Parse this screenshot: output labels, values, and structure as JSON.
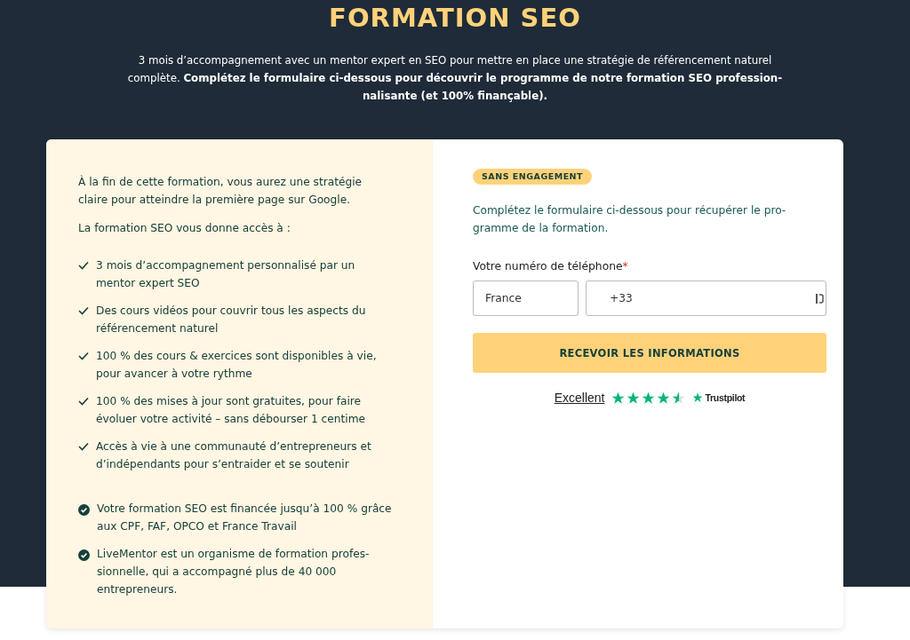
{
  "header": {
    "title": "FORMATION SEO",
    "intro": "3 mois d’accompagnement avec un mentor expert en SEO pour mettre en place une stratégie de référencement naturel complète. **Complétez le formulaire ci-dessous pour découvrir le programme de notre formation SEO profession-nalisante (et 100% finançable).**"
  },
  "benefits": {
    "intro": "À la fin de cette formation, vous aurez une stratégie claire pour atteindre la première page sur Google.",
    "lead": "La formation SEO vous donne accès à :",
    "items": [
      {
        "kind": "check",
        "text": "3 mois d’accompagnement personnalisé par un mentor expert SEO"
      },
      {
        "kind": "check",
        "text": "Des cours vidéos pour couvrir tous les aspects du référencement naturel"
      },
      {
        "kind": "check",
        "text": "100 % des cours & exercices sont disponibles à vie, pour avancer à votre rythme"
      },
      {
        "kind": "check",
        "text": "100 % des mises à jour sont gratuites, pour faire évoluer votre activité – sans débourser 1 centime"
      },
      {
        "kind": "check",
        "text": "Accès à vie à une communauté d’entrepreneurs et d’indépendants pour s’entraider et se soutenir"
      },
      {
        "kind": "badge-check",
        "text": "Votre formation SEO est financée jusqu’à 100 % grâce aux CPF, FAF, OPCO et France Travail"
      },
      {
        "kind": "badge-check",
        "text": "LiveMentor est un organisme de formation profes-sionnelle, qui a accompagné plus de 40 000 entrepreneurs."
      }
    ]
  },
  "form": {
    "badge": "SANS ENGAGEMENT",
    "intro": "Complétez le formulaire ci-dessous pour récupérer le pro-gramme de la formation.",
    "phone_label": "Votre numéro de téléphone",
    "required_mark": "*",
    "country": "France",
    "phone_value": "+33",
    "submit": "RECEVOIR LES INFORMATIONS",
    "rating": {
      "label": "Excellent",
      "stars": 4.5,
      "brand": "Trustpilot"
    }
  }
}
